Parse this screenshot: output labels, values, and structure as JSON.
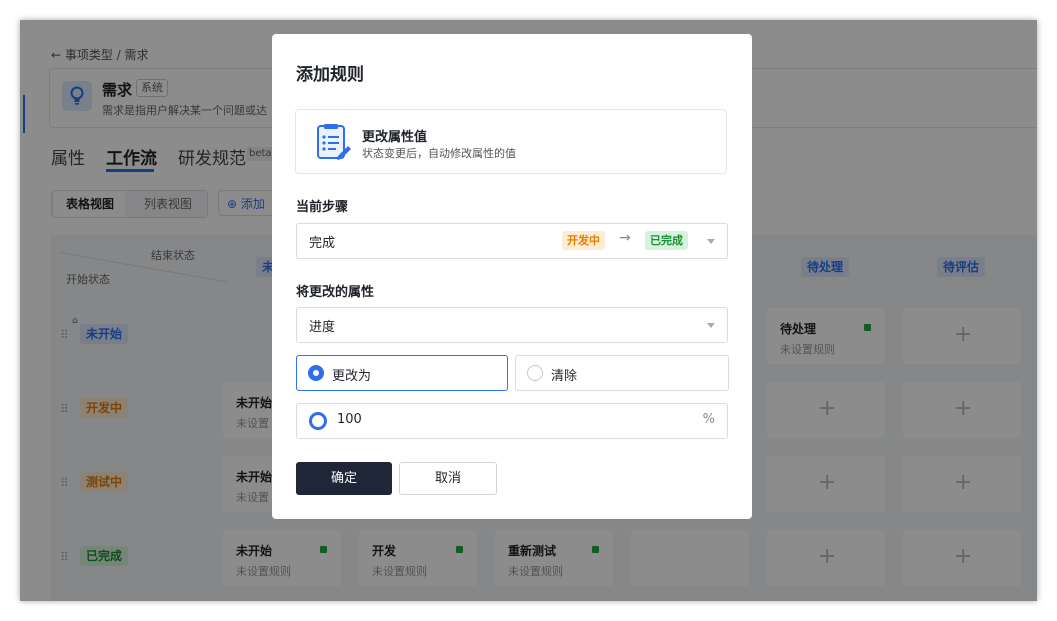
{
  "background": {
    "breadcrumb": "← 事项类型 / 需求",
    "issue_type": {
      "name": "需求",
      "tag": "系统",
      "description": "需求是指用户解决某一个问题或达"
    },
    "tabs": [
      {
        "label": "属性"
      },
      {
        "label": "工作流"
      },
      {
        "label": "研发规范"
      }
    ],
    "beta_tag": "beta",
    "view_toggle": [
      "表格视图",
      "列表视图"
    ],
    "add_button": "添加",
    "matrix": {
      "end_state_label": "结束状态",
      "start_state_label": "开始状态",
      "column_headers": [
        "未",
        "待处理",
        "待评估"
      ],
      "rows": [
        {
          "label": "未开始",
          "color": "#2f6fed"
        },
        {
          "label": "开发中",
          "color": "#e67e00"
        },
        {
          "label": "测试中",
          "color": "#e67e00"
        },
        {
          "label": "已完成",
          "color": "#1a8f35"
        }
      ],
      "cells": {
        "r1_pending": {
          "name": "待处理",
          "sub": "未设置规则"
        },
        "r2_c1": {
          "name": "未开始",
          "sub": "未设置"
        },
        "r3_c1": {
          "name": "未开始",
          "sub": "未设置"
        },
        "r4_c1": {
          "name": "未开始",
          "sub": "未设置规则"
        },
        "r4_c2": {
          "name": "开发",
          "sub": "未设置规则"
        },
        "r4_c3": {
          "name": "重新测试",
          "sub": "未设置规则"
        }
      }
    }
  },
  "modal": {
    "title": "添加规则",
    "action_card": {
      "title": "更改属性值",
      "subtitle": "状态变更后，自动修改属性的值"
    },
    "current_step": {
      "label": "当前步骤",
      "value": "完成",
      "from_state": "开发中",
      "to_state": "已完成"
    },
    "property": {
      "label": "将更改的属性",
      "value": "进度"
    },
    "options": {
      "change_to": "更改为",
      "clear": "清除",
      "selected": "更改为"
    },
    "progress_value": "100",
    "unit": "%",
    "confirm_label": "确定",
    "cancel_label": "取消"
  }
}
